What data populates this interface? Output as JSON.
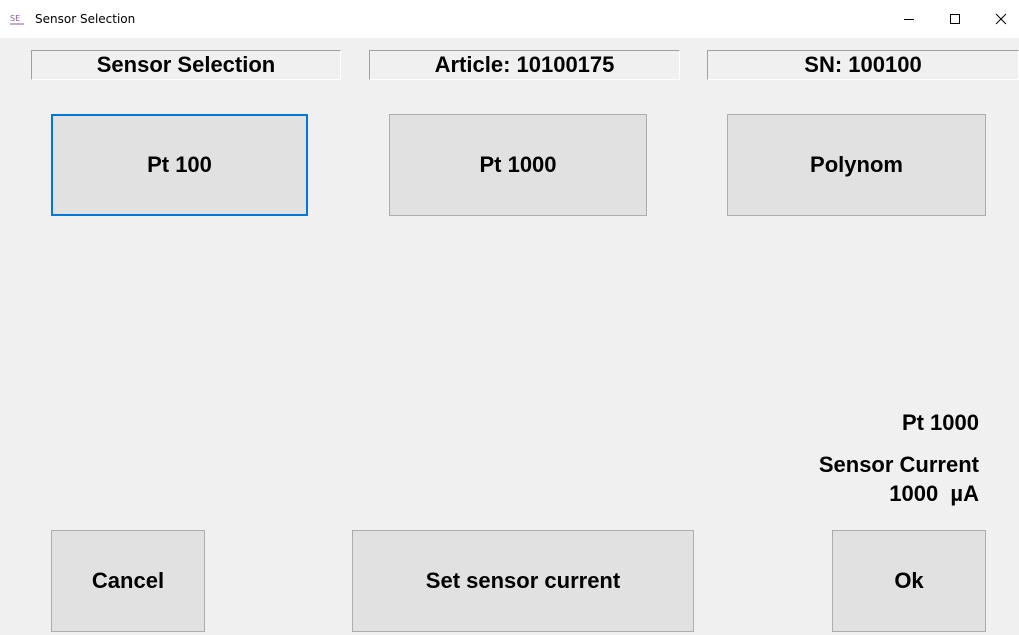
{
  "window": {
    "title": "Sensor Selection",
    "app_icon": "app-icon",
    "controls": {
      "minimize": "—",
      "maximize": "☐",
      "close": "✕"
    }
  },
  "header": {
    "title": "Sensor Selection",
    "article": "Article: 10100175",
    "serial": "SN: 100100"
  },
  "sensor_buttons": {
    "pt100": "Pt 100",
    "pt1000": "Pt 1000",
    "polynom": "Polynom"
  },
  "status": {
    "selected_sensor": "Pt 1000",
    "current_label": "Sensor Current",
    "current_value": "1000  µA"
  },
  "footer": {
    "cancel": "Cancel",
    "set_sensor_current": "Set sensor current",
    "ok": "Ok"
  },
  "colors": {
    "focus_border": "#0078d7",
    "button_face": "#e1e1e1",
    "window_bg": "#f0f0f0"
  }
}
